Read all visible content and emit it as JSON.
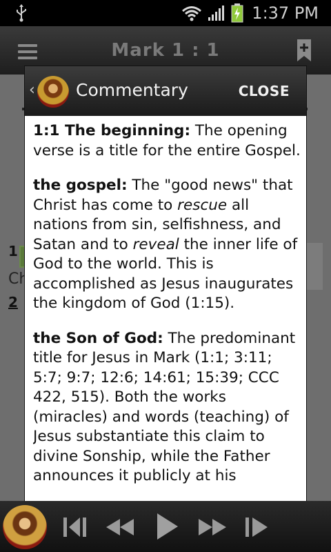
{
  "status_bar": {
    "time": "1:37 PM",
    "icons": [
      "usb-icon",
      "wifi-icon",
      "signal-icon",
      "battery-charging-icon"
    ]
  },
  "app_bar": {
    "title": "Mark  1 : 1",
    "icons": [
      "menu-icon",
      "bookmark-add-icon"
    ]
  },
  "background": {
    "verse1_num": "1",
    "verse_fragment": "Ch",
    "verse2_num": "2"
  },
  "dialog": {
    "title": "Commentary",
    "close_label": "CLOSE",
    "back_glyph": "‹",
    "entries": [
      {
        "term": "1:1 The beginning:",
        "text": " The opening verse is a title for the entire Gospel."
      },
      {
        "term": "the gospel:",
        "text": " The \"good news\" that Christ has come to ",
        "em1": "rescue",
        "text2": " all nations from sin, selfishness, and Satan and to ",
        "em2": "reveal",
        "text3": " the inner life of God to the world. This is accomplished as Jesus inaugurates the kingdom of God (1:15)."
      },
      {
        "term": "the Son of God:",
        "text": " The predominant title for Jesus in Mark (1:1; 3:11; 5:7; 9:7; 12:6; 14:61; 15:39; CCC 422, 515). Both the works (miracles) and words (teaching) of Jesus substantiate this claim to divine Sonship, while the Father announces it publicly at his"
      }
    ]
  },
  "player": {
    "controls": [
      "previous-track-icon",
      "rewind-icon",
      "play-icon",
      "fast-forward-icon",
      "next-track-icon"
    ]
  }
}
